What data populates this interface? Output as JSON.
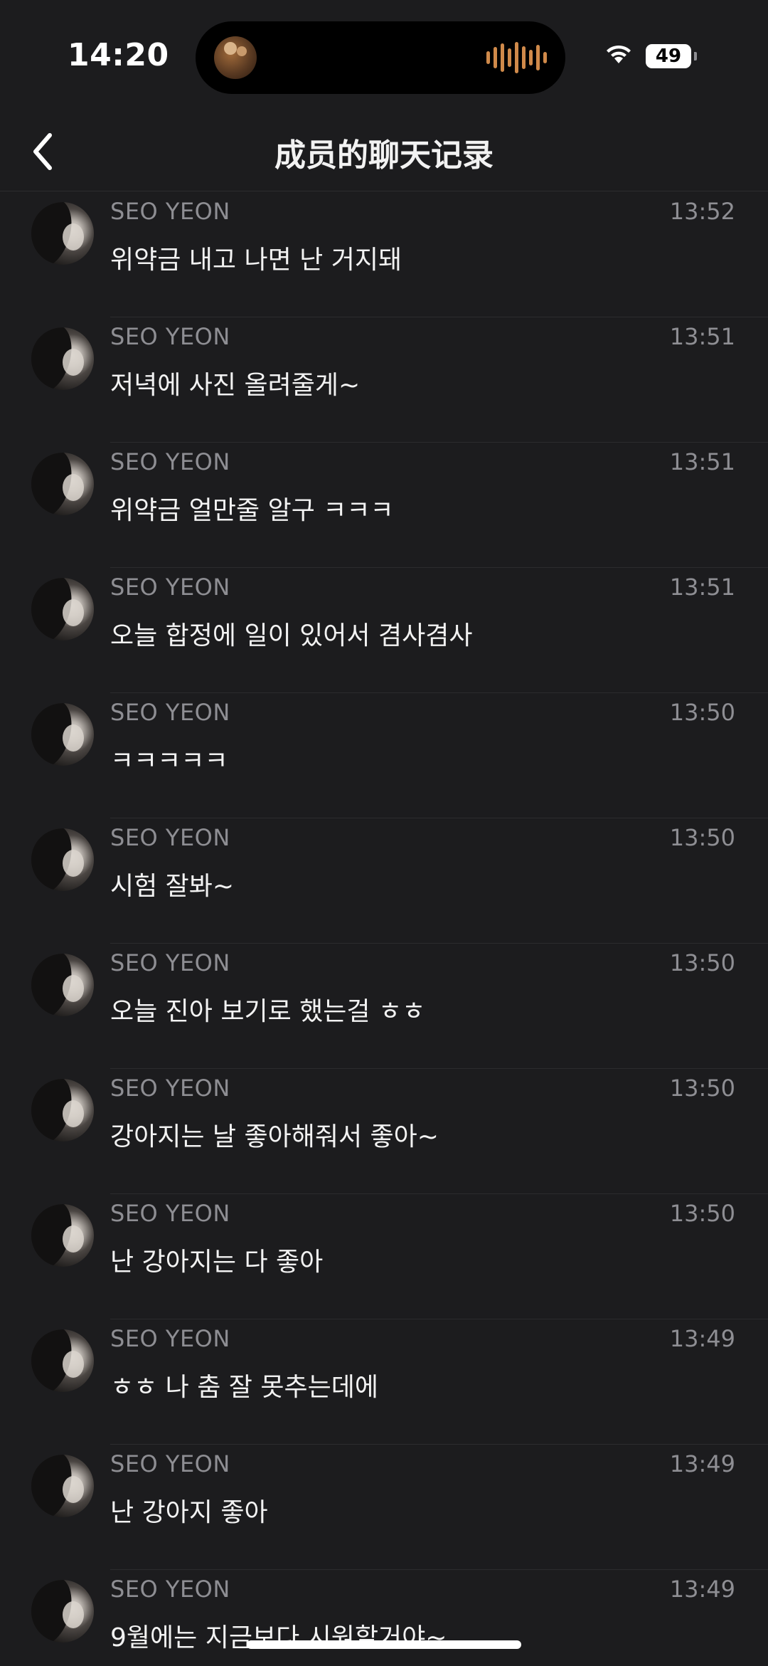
{
  "status_bar": {
    "time": "14:20",
    "battery": "49"
  },
  "nav": {
    "title": "成员的聊天记录"
  },
  "messages": [
    {
      "sender": "SEO YEON",
      "time": "13:52",
      "text": "위약금 내고 나면 난 거지돼"
    },
    {
      "sender": "SEO YEON",
      "time": "13:51",
      "text": "저녁에 사진 올려줄게~"
    },
    {
      "sender": "SEO YEON",
      "time": "13:51",
      "text": "위약금 얼만줄 알구 ㅋㅋㅋ"
    },
    {
      "sender": "SEO YEON",
      "time": "13:51",
      "text": "오늘 합정에 일이 있어서 겸사겸사"
    },
    {
      "sender": "SEO YEON",
      "time": "13:50",
      "text": "ㅋㅋㅋㅋㅋ"
    },
    {
      "sender": "SEO YEON",
      "time": "13:50",
      "text": "시험 잘봐~"
    },
    {
      "sender": "SEO YEON",
      "time": "13:50",
      "text": "오늘 진아 보기로 했는걸 ㅎㅎ"
    },
    {
      "sender": "SEO YEON",
      "time": "13:50",
      "text": "강아지는 날 좋아해줘서 좋아~"
    },
    {
      "sender": "SEO YEON",
      "time": "13:50",
      "text": "난 강아지는 다 좋아"
    },
    {
      "sender": "SEO YEON",
      "time": "13:49",
      "text": "ㅎㅎ 나 춤 잘 못추는데에"
    },
    {
      "sender": "SEO YEON",
      "time": "13:49",
      "text": "난 강아지 좋아"
    },
    {
      "sender": "SEO YEON",
      "time": "13:49",
      "text": "9월에는 지금보다 시원할거야~"
    }
  ]
}
